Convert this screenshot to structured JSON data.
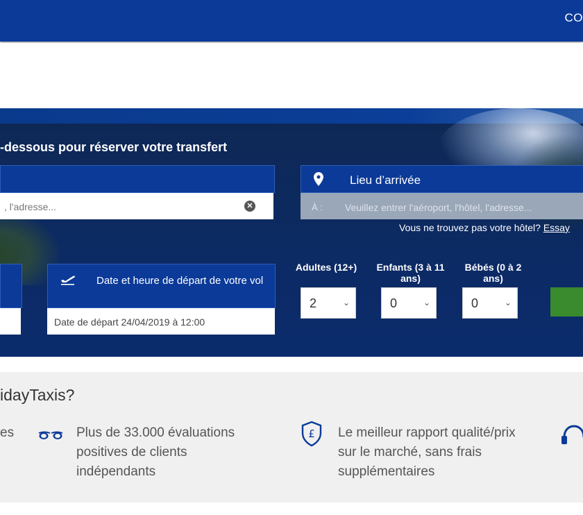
{
  "header": {
    "nav_link": "CO"
  },
  "hero": {
    "title": "-dessous pour réserver votre transfert",
    "pickup": {
      "placeholder": ", l'adresse...",
      "clear_icon": "clear-icon"
    },
    "arrival": {
      "label": "Lieu d’arrivée",
      "prefix": "À :",
      "placeholder": "Veuillez entrer l'aéroport, l'hôtel, l'adresse...",
      "icon": "map-pin-icon"
    },
    "hotel_note": {
      "text": "Vous ne trouvez pas votre hôtel?",
      "link": "Essay"
    },
    "departure": {
      "label": "Date et heure de départ de votre vol",
      "value": "Date de départ 24/04/2019 à 12:00",
      "icon": "plane-takeoff-icon"
    },
    "passengers": {
      "adults": {
        "label": "Adultes (12+)",
        "value": "2"
      },
      "children": {
        "label": "Enfants (3 à 11 ans)",
        "value": "0"
      },
      "infants": {
        "label": "Bébés (0 à 2 ans)",
        "value": "0"
      }
    }
  },
  "why": {
    "title": "idayTaxis?",
    "feature0_fragment": "es",
    "feature1": "Plus de 33.000 évaluations positives de clients indépendants",
    "feature2": "Le meilleur rapport qualité/prix sur le marché, sans frais supplémentaires",
    "icons": [
      "glasses-icon",
      "shield-pound-icon",
      "headset-icon"
    ]
  },
  "colors": {
    "brand_blue": "#0b3a98",
    "go_green": "#3a8a2e",
    "footer_grey": "#f0f0f0"
  }
}
